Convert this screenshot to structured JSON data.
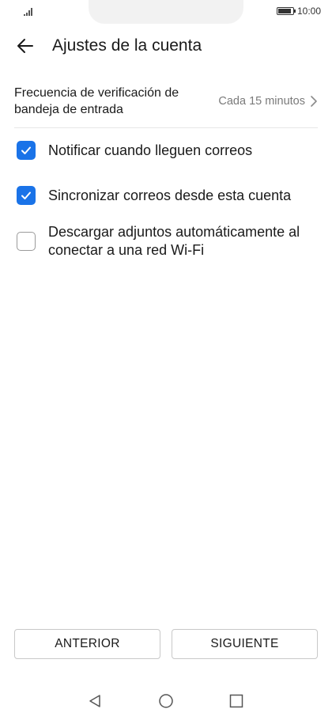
{
  "status_bar": {
    "time": "10:00",
    "signal_icon": "signal-icon",
    "battery_icon": "battery-icon"
  },
  "app_bar": {
    "back_icon": "arrow-left-icon",
    "title": "Ajustes de la cuenta"
  },
  "settings": {
    "frequency": {
      "label": "Frecuencia de verificación de bandeja de entrada",
      "value": "Cada 15 minutos",
      "chevron_icon": "chevron-right-icon"
    },
    "options": [
      {
        "label": "Notificar cuando lleguen correos",
        "checked": true
      },
      {
        "label": "Sincronizar correos desde esta cuenta",
        "checked": true
      },
      {
        "label": "Descargar adjuntos automáticamente al conectar a una red Wi-Fi",
        "checked": false
      }
    ]
  },
  "buttons": {
    "previous": "ANTERIOR",
    "next": "SIGUIENTE"
  },
  "nav_bar": {
    "back": "triangle-back-icon",
    "home": "circle-home-icon",
    "recents": "square-recents-icon"
  },
  "colors": {
    "accent": "#1a73e8",
    "text": "#1a1a1a",
    "secondary_text": "#7a7a7a"
  }
}
